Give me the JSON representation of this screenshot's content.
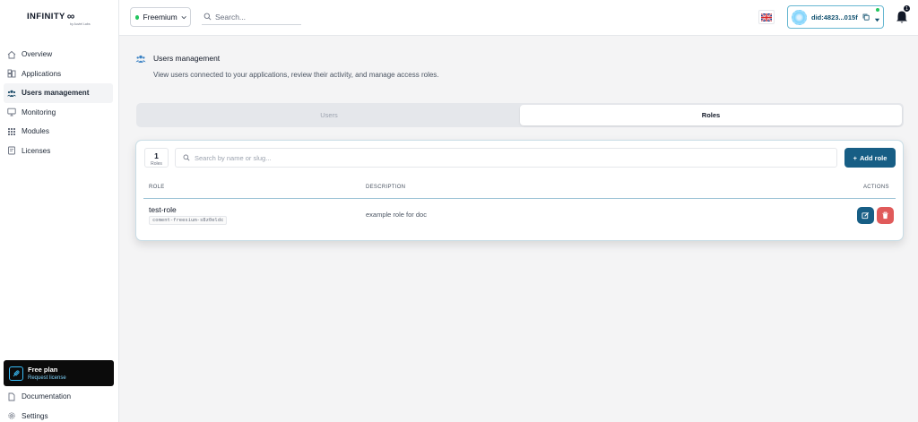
{
  "brand": {
    "name": "INFINITY",
    "tagline": "by Auviel Labs"
  },
  "sidebar": {
    "items": [
      {
        "label": "Overview",
        "icon": "home-icon"
      },
      {
        "label": "Applications",
        "icon": "applications-icon"
      },
      {
        "label": "Users management",
        "icon": "users-icon",
        "active": true
      },
      {
        "label": "Monitoring",
        "icon": "monitor-icon"
      },
      {
        "label": "Modules",
        "icon": "grid-icon"
      },
      {
        "label": "Licenses",
        "icon": "license-icon"
      }
    ],
    "plan": {
      "title": "Free plan",
      "link": "Request license"
    },
    "bottom": [
      {
        "label": "Documentation",
        "icon": "document-icon"
      },
      {
        "label": "Settings",
        "icon": "gear-icon"
      }
    ]
  },
  "header": {
    "plan_selector": "Freemium",
    "search_placeholder": "Search...",
    "wallet": "did:4823...015f",
    "notifications_count": "1",
    "colors": {
      "status": "#22c55e",
      "accent": "#175e85"
    }
  },
  "page": {
    "title": "Users management",
    "description": "View users connected to your applications, review their activity, and manage access roles."
  },
  "tabs": [
    {
      "label": "Users",
      "active": false
    },
    {
      "label": "Roles",
      "active": true
    }
  ],
  "roles_panel": {
    "count": "1",
    "count_label": "Roles",
    "search_placeholder": "Search by name or slug...",
    "add_button": "Add role",
    "columns": {
      "role": "ROLE",
      "description": "DESCRIPTION",
      "actions": "ACTIONS"
    },
    "rows": [
      {
        "name": "test-role",
        "slug": "coment-freesium-s8z0eldc",
        "description": "example role for doc"
      }
    ]
  }
}
